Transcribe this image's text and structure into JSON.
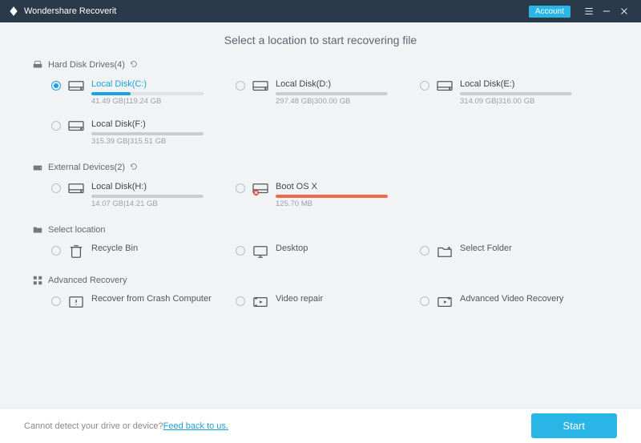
{
  "app": {
    "title": "Wondershare Recoverit",
    "account": "Account"
  },
  "page": {
    "title": "Select a location to start recovering file"
  },
  "sections": {
    "hdd": {
      "label": "Hard Disk Drives(4)"
    },
    "ext": {
      "label": "External Devices(2)"
    },
    "sel": {
      "label": "Select location"
    },
    "adv": {
      "label": "Advanced Recovery"
    }
  },
  "drives": {
    "c": {
      "name": "Local Disk(C:)",
      "size": "41.49 GB|119.24 GB",
      "pct": 35
    },
    "d": {
      "name": "Local Disk(D:)",
      "size": "297.48 GB|300.00 GB",
      "pct": 99
    },
    "e": {
      "name": "Local Disk(E:)",
      "size": "314.09 GB|316.00 GB",
      "pct": 99
    },
    "f": {
      "name": "Local Disk(F:)",
      "size": "315.39 GB|315.51 GB",
      "pct": 100
    },
    "h": {
      "name": "Local Disk(H:)",
      "size": "14.07 GB|14.21 GB",
      "pct": 99
    },
    "boot": {
      "name": "Boot OS X",
      "size": "125.70 MB",
      "pct": 100
    }
  },
  "locations": {
    "recycle": "Recycle Bin",
    "desktop": "Desktop",
    "folder": "Select Folder"
  },
  "advanced": {
    "crash": "Recover from Crash Computer",
    "video": "Video repair",
    "advvideo": "Advanced Video Recovery"
  },
  "footer": {
    "msg": "Cannot detect your drive or device? ",
    "link": "Feed back to us.",
    "start": "Start"
  }
}
